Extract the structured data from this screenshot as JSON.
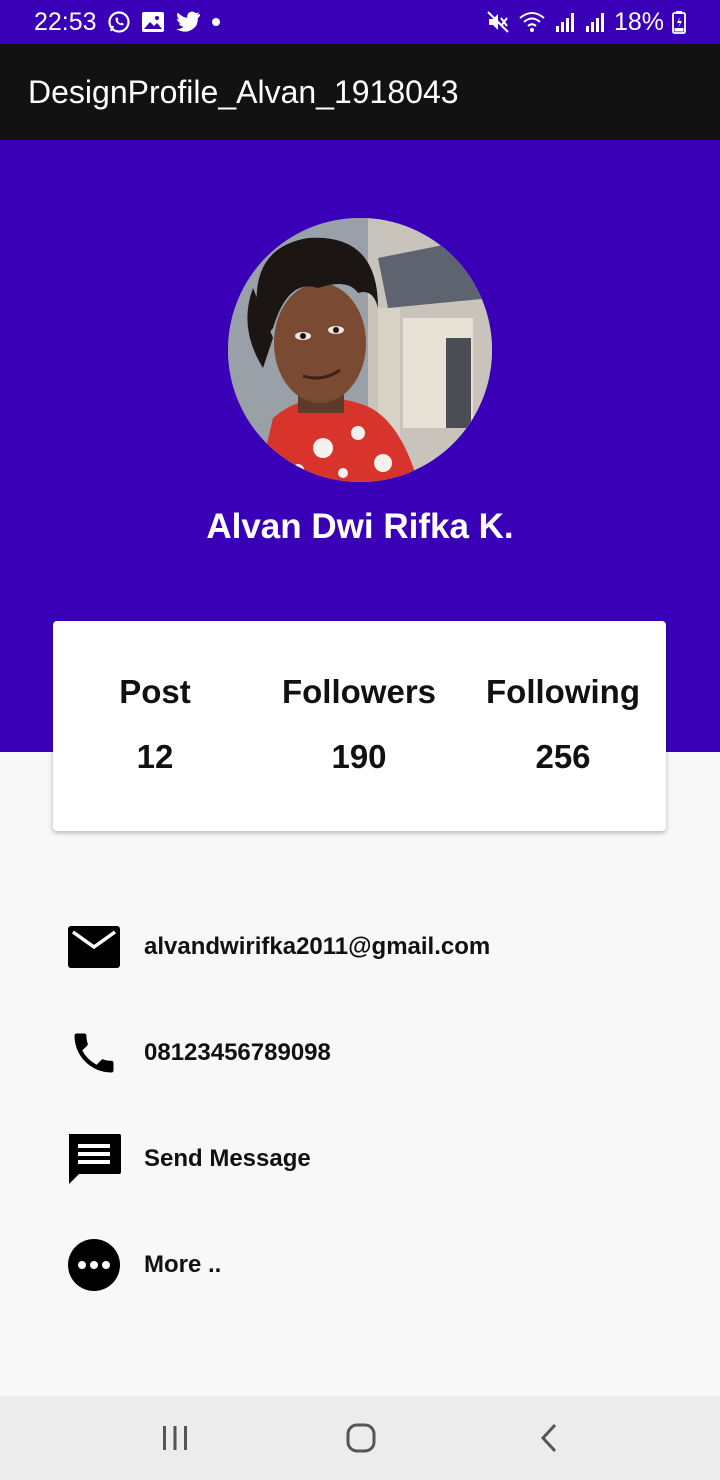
{
  "status_bar": {
    "time": "22:53",
    "battery": "18%",
    "icons_left": [
      "whatsapp-icon",
      "gallery-icon",
      "twitter-icon",
      "dot-icon"
    ],
    "icons_right": [
      "mute-icon",
      "wifi-icon",
      "signal-icon",
      "signal-icon",
      "battery-icon"
    ]
  },
  "app_bar": {
    "title": "DesignProfile_Alvan_1918043"
  },
  "header": {
    "background_color": "#3a00b7",
    "name": "Alvan Dwi Rifka K."
  },
  "stats": [
    {
      "label": "Post",
      "value": "12"
    },
    {
      "label": "Followers",
      "value": "190"
    },
    {
      "label": "Following",
      "value": "256"
    }
  ],
  "contacts": [
    {
      "icon": "email-icon",
      "label": "alvandwirifka2011@gmail.com"
    },
    {
      "icon": "phone-icon",
      "label": "08123456789098"
    },
    {
      "icon": "message-icon",
      "label": "Send Message"
    },
    {
      "icon": "more-icon",
      "label": "More .."
    }
  ],
  "nav_bar": {
    "buttons": [
      "recent-apps-icon",
      "home-icon",
      "back-icon"
    ]
  }
}
